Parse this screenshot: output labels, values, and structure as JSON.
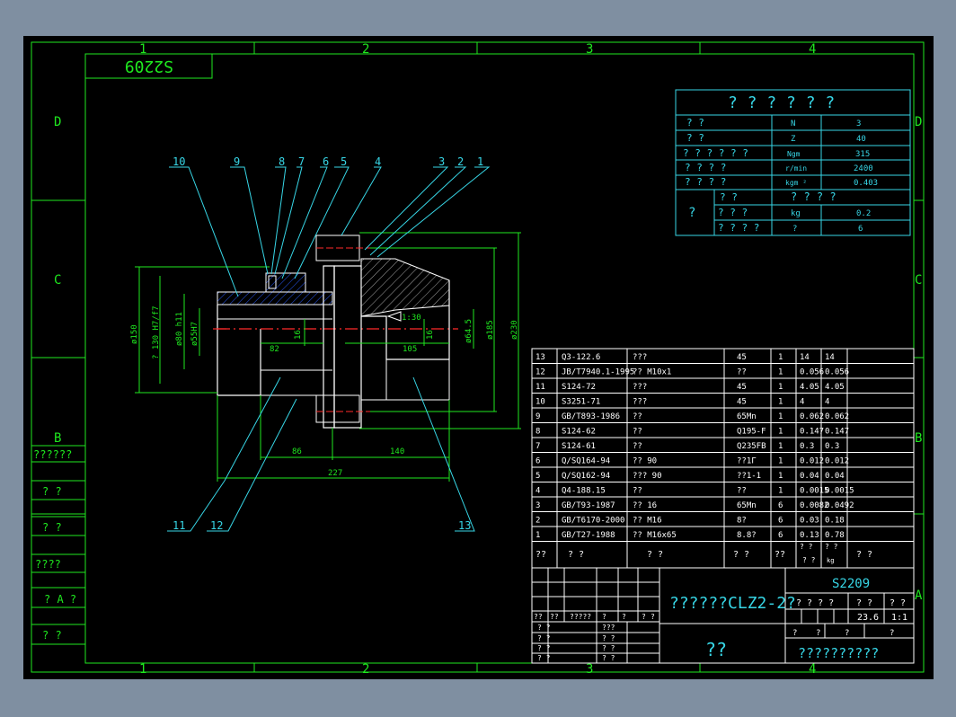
{
  "drawing": {
    "code": "S2209",
    "code_mirrored": "S2209",
    "grid_cols": [
      "1",
      "2",
      "3",
      "4"
    ],
    "grid_rows": [
      "D",
      "C",
      "B",
      "A"
    ]
  },
  "left_stamp": [
    "??????",
    "?  ?",
    "?  ?",
    "????",
    "? A ?",
    "?  ?"
  ],
  "param_table": {
    "title": "? ? ? ? ? ?",
    "rows": [
      {
        "name": "?   ?",
        "unit": "N",
        "value": "3"
      },
      {
        "name": "?   ?",
        "unit": "Z",
        "value": "40"
      },
      {
        "name": "? ? ? ? ? ?",
        "unit": "Ngm",
        "value": "315"
      },
      {
        "name": "? ? ? ?",
        "unit": "r/min",
        "value": "2400"
      },
      {
        "name": "? ? ? ?",
        "unit": "kgm ²",
        "value": "0.403"
      }
    ],
    "sub_header": "? ? ? ?",
    "group_label": "?",
    "sub_rows": [
      {
        "name": "?  ?",
        "unit": "",
        "value": ""
      },
      {
        "name": "? ? ?",
        "unit": "kg",
        "value": "0.2"
      },
      {
        "name": "? ? ? ?",
        "unit": "?",
        "value": "6"
      }
    ],
    "sub_name_col1": "?  ?"
  },
  "parts_list": {
    "rows": [
      [
        "13",
        "Q3-122.6",
        "???",
        "45",
        "1",
        "14",
        "14"
      ],
      [
        "12",
        "JB/T7940.1-1995",
        "?? M10x1",
        "??",
        "1",
        "0.056",
        "0.056"
      ],
      [
        "11",
        "S124-72",
        "???",
        "45",
        "1",
        "4.05",
        "4.05"
      ],
      [
        "10",
        "S3251-71",
        "???",
        "45",
        "1",
        "4",
        "4"
      ],
      [
        "9",
        "GB/T893-1986",
        "??",
        "65Mn",
        "1",
        "0.062",
        "0.062"
      ],
      [
        "8",
        "S124-62",
        "??",
        "Q195-F",
        "1",
        "0.147",
        "0.147"
      ],
      [
        "7",
        "S124-61",
        "??",
        "Q235FB",
        "1",
        "0.3",
        "0.3"
      ],
      [
        "6",
        "Q/SQ164-94",
        "??   90",
        "??1Γ",
        "1",
        "0.012",
        "0.012"
      ],
      [
        "5",
        "Q/SQ162-94",
        "???  90",
        "??1-1",
        "1",
        "0.04",
        "0.04"
      ],
      [
        "4",
        "Q4-188.15",
        "??",
        "??",
        "1",
        "0.0015",
        "0.0015"
      ],
      [
        "3",
        "GB/T93-1987",
        "?? 16",
        "65Mn",
        "6",
        "0.0082",
        "0.0492"
      ],
      [
        "2",
        "GB/T6170-2000",
        "?? M16",
        "8?",
        "6",
        "0.03",
        "0.18"
      ],
      [
        "1",
        "GB/T27-1988",
        "?? M16x65",
        "8.8?",
        "6",
        "0.13",
        "0.78"
      ]
    ],
    "header": [
      "??",
      "?  ?",
      "?  ?",
      "? ?",
      "??",
      "? ?",
      "? ?",
      "?  ?",
      "kg",
      "?  ?"
    ]
  },
  "title_block": {
    "name": "??????CLZ2-2?",
    "code": "S2209",
    "company": "??",
    "material": "??????????",
    "labels_top": [
      "? ? ? ?",
      "?  ?",
      "?  ?"
    ],
    "weight": "23.6",
    "scale": "1:1",
    "sign_labels": [
      "??",
      "??",
      "?????",
      "?",
      "?",
      "?",
      "?"
    ],
    "sign_rows": [
      "?  ?",
      "?  ?",
      "?  ?",
      "?  ?"
    ],
    "sign_rows2": [
      "???",
      "?  ?",
      "?  ?",
      "?  ?"
    ],
    "sheet_labels": [
      "?",
      "?",
      "?",
      "?"
    ]
  },
  "callouts": [
    "10",
    "9",
    "8",
    "7",
    "6",
    "5",
    "4",
    "3",
    "2",
    "1",
    "11",
    "12",
    "13"
  ],
  "dimensions": {
    "d150": "ø150",
    "d130": "? 130 H7/f7",
    "d80": "ø80 h11",
    "d55": "ø55H7",
    "d185": "ø185",
    "d230": "ø230",
    "d64": "ø64.5",
    "l82": "82",
    "l16a": "16",
    "l16b": "16",
    "l105": "105",
    "l86": "86",
    "l140": "140",
    "l227": "227",
    "taper": "1:30"
  }
}
